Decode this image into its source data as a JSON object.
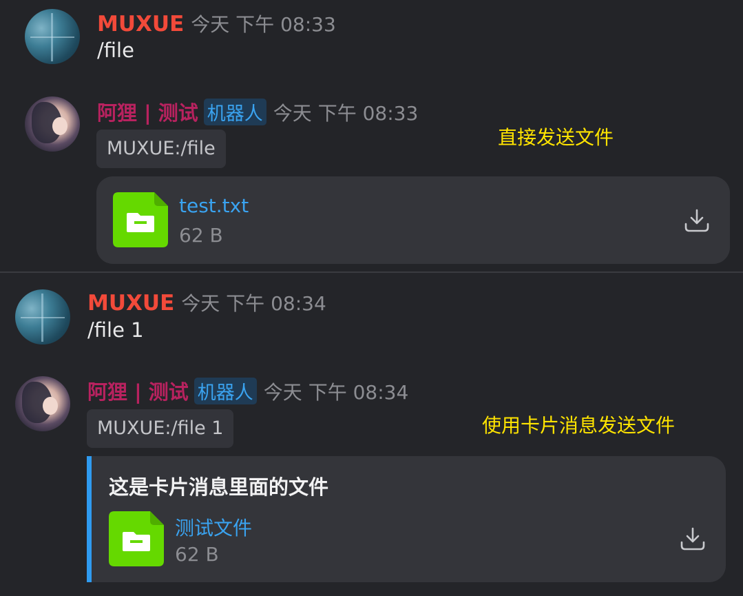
{
  "messages": [
    {
      "user": "MUXUE",
      "time": "今天 下午 08:33",
      "text": "/file"
    },
    {
      "user": "阿狸 | 测试",
      "badge": "机器人",
      "time": "今天 下午 08:33",
      "quote": "MUXUE:/file",
      "annotation": "直接发送文件",
      "file": {
        "name": "test.txt",
        "size": "62 B",
        "icon": "folder-icon"
      }
    },
    {
      "user": "MUXUE",
      "time": "今天 下午 08:34",
      "text": "/file 1"
    },
    {
      "user": "阿狸 | 测试",
      "badge": "机器人",
      "time": "今天 下午 08:34",
      "quote": "MUXUE:/file 1",
      "annotation": "使用卡片消息发送文件",
      "card": {
        "title": "这是卡片消息里面的文件",
        "file": {
          "name": "测试文件",
          "size": "62 B",
          "icon": "folder-icon"
        }
      }
    }
  ],
  "colors": {
    "background": "#232428",
    "username_user": "#f24a3a",
    "username_bot": "#b8225f",
    "bot_badge": "#3aa3f0",
    "link": "#3aa3f0",
    "annotation": "#ffe400",
    "file_icon": "#65d900",
    "card_accent": "#2f9bf0"
  }
}
